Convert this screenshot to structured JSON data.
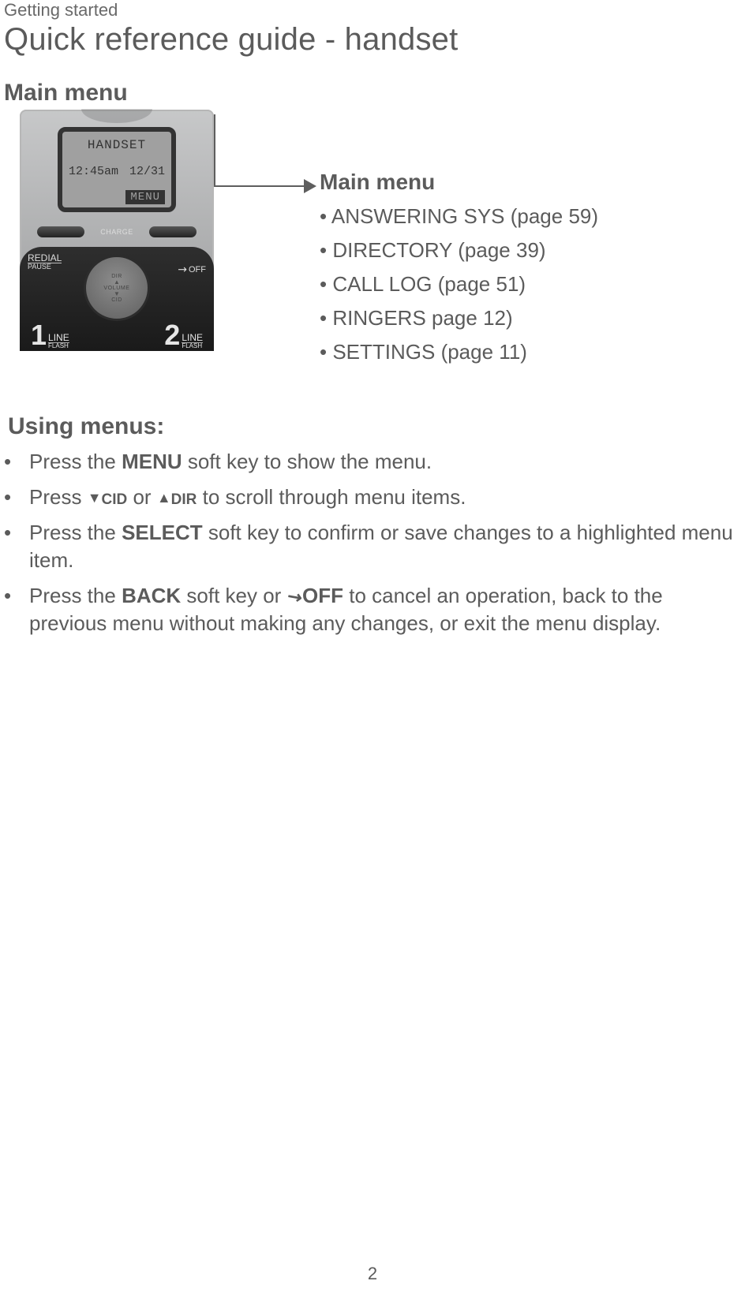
{
  "section": "Getting started",
  "title": "Quick reference guide - handset",
  "main_menu_heading": "Main menu",
  "handset": {
    "display_line1": "HANDSET",
    "display_time": "12:45am",
    "display_date": "12/31",
    "soft_menu": "MENU",
    "charge_label": "CHARGE",
    "redial_top": "REDIAL",
    "redial_bottom": "PAUSE",
    "nav_top": "DIR",
    "nav_volume": "VOLUME",
    "nav_bottom": "CID",
    "nav_right": "OFF",
    "line1_num": "1",
    "line1_label": "LINE",
    "line1_small": "FLASH",
    "line2_num": "2",
    "line2_label": "LINE",
    "line2_small": "FLASH"
  },
  "callout_title": "Main menu",
  "menu_items": [
    "ANSWERING SYS (page 59)",
    "DIRECTORY (page 39)",
    "CALL LOG (page 51)",
    "RINGERS page 12)",
    "SETTINGS (page 11)"
  ],
  "using_menus_heading": "Using menus:",
  "steps": {
    "s1_a": "Press the ",
    "s1_b": "MENU",
    "s1_c": " soft key to show the menu.",
    "s2_a": "Press ",
    "s2_cid": "CID",
    "s2_or": " or ",
    "s2_dir": "DIR",
    "s2_b": " to scroll through menu items.",
    "s3_a": "Press the ",
    "s3_b": "SELECT",
    "s3_c": " soft key to confirm or save changes to a highlighted menu item.",
    "s4_a": "Press the ",
    "s4_b": "BACK",
    "s4_c": " soft key or ",
    "s4_off": "OFF",
    "s4_d": " to cancel an operation, back to the previous menu without making any changes, or exit the menu display."
  },
  "page_number": "2"
}
